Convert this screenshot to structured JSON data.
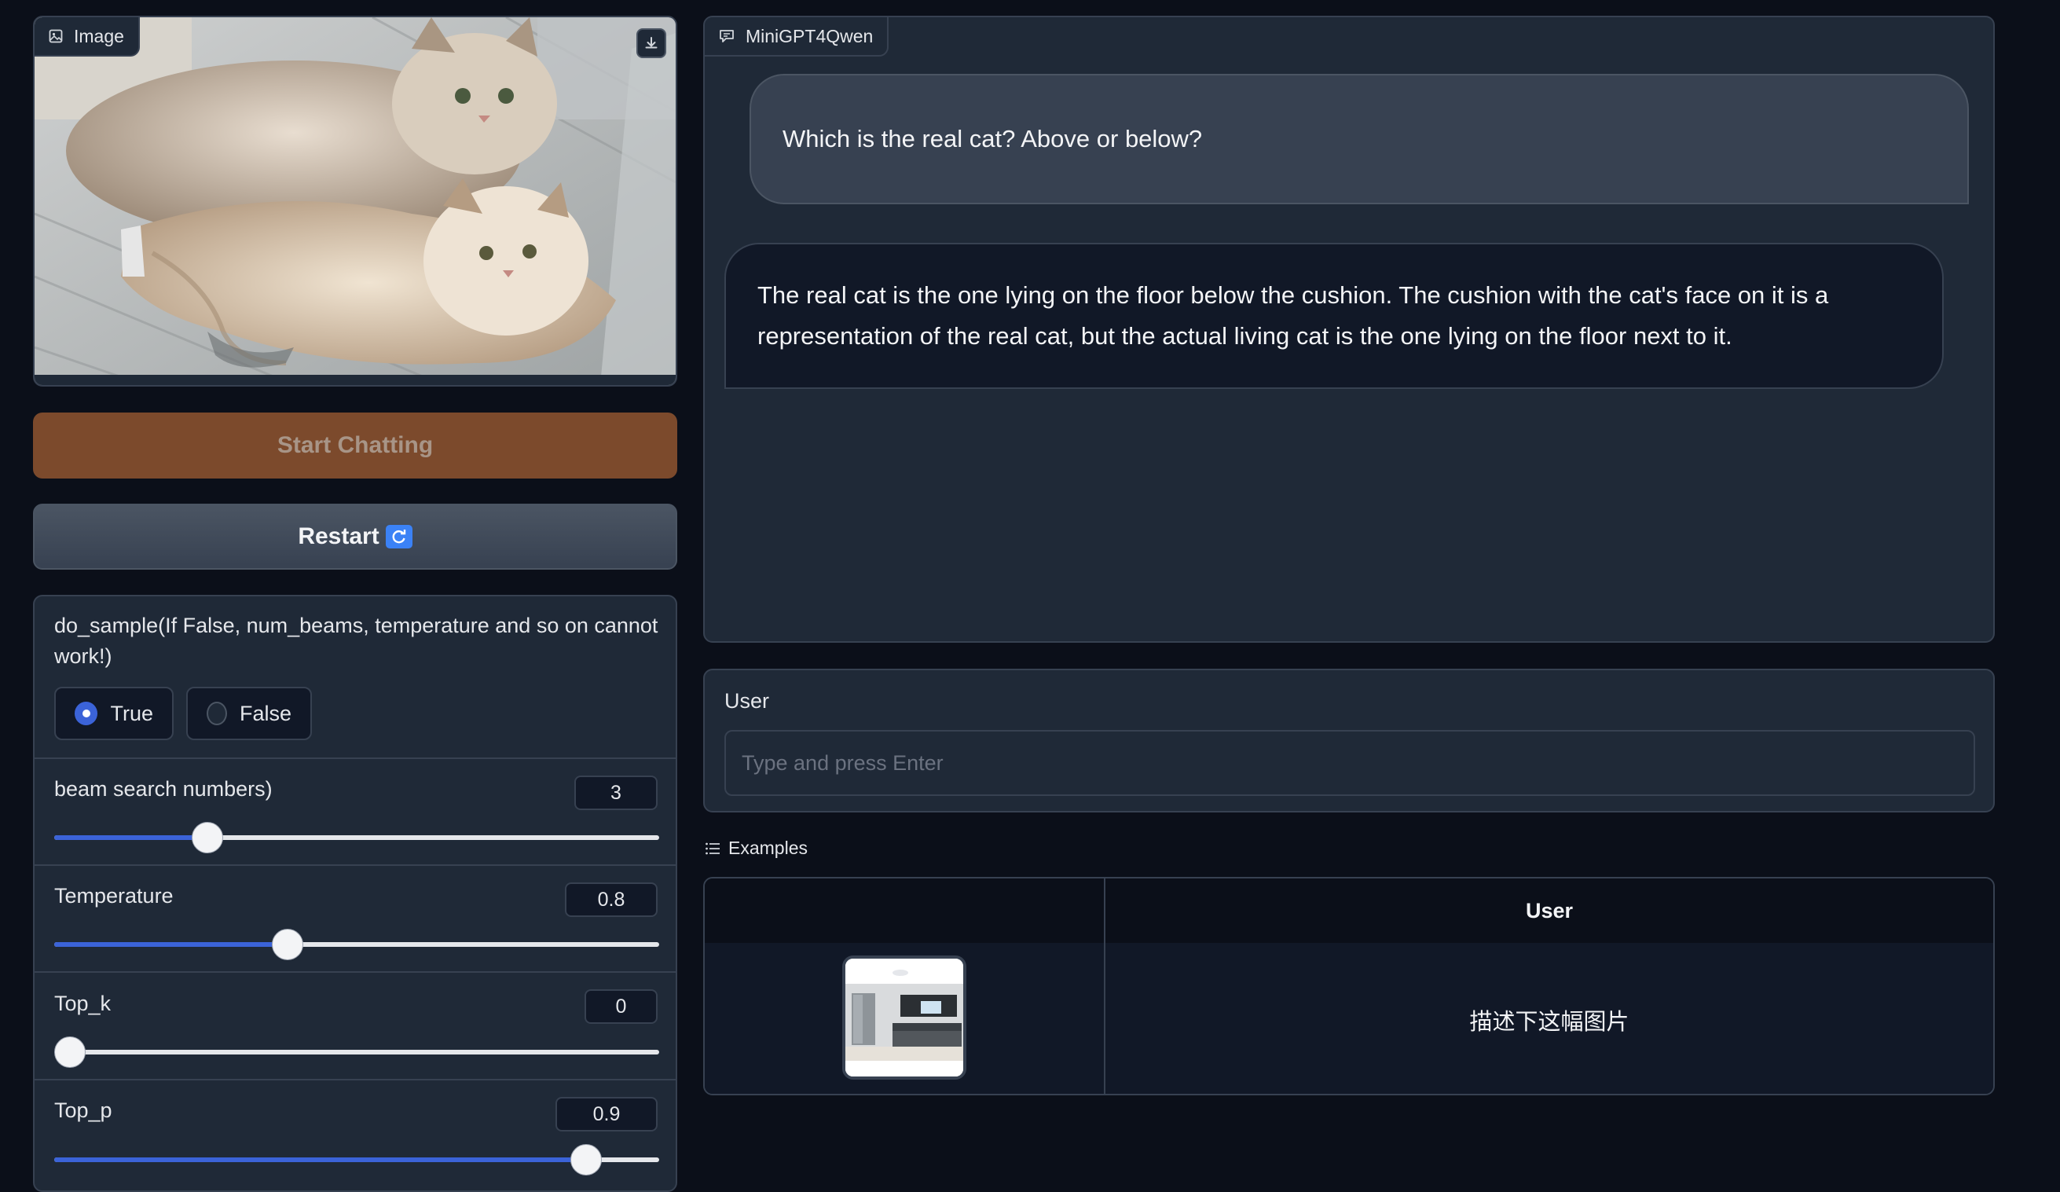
{
  "image_panel": {
    "label": "Image",
    "icon": "image-icon",
    "download_icon": "download-icon"
  },
  "buttons": {
    "start": "Start Chatting",
    "restart": "Restart"
  },
  "settings": {
    "do_sample": {
      "label": "do_sample(If False, num_beams, temperature and so on cannot work!)",
      "options": [
        "True",
        "False"
      ],
      "selected": "True"
    },
    "sliders": [
      {
        "label": "beam search numbers)",
        "value": "3",
        "fill_fraction": 0.24
      },
      {
        "label": "Temperature",
        "value": "0.8",
        "fill_fraction": 0.38
      },
      {
        "label": "Top_k",
        "value": "0",
        "fill_fraction": 0.0
      },
      {
        "label": "Top_p",
        "value": "0.9",
        "fill_fraction": 0.9
      }
    ]
  },
  "chat": {
    "label": "MiniGPT4Qwen",
    "icon": "chat-icon",
    "messages": [
      {
        "role": "user",
        "text": "Which is the real cat? Above or below?"
      },
      {
        "role": "bot",
        "text": "The real cat is the one lying on the floor below the cushion. The cushion with the cat's face on it is a representation of the real cat, but the actual living cat is the one lying on the floor next to it."
      }
    ]
  },
  "user_input": {
    "label": "User",
    "placeholder": "Type and press Enter",
    "value": ""
  },
  "examples": {
    "label": "Examples",
    "icon": "list-icon",
    "columns": [
      "",
      "User"
    ],
    "rows": [
      {
        "image": "kitchen-thumbnail",
        "text": "描述下这幅图片"
      }
    ]
  },
  "colors": {
    "background": "#0b0f19",
    "panel": "#1f2937",
    "accent": "#3b63d8",
    "start_button": "#7c4a2c"
  }
}
